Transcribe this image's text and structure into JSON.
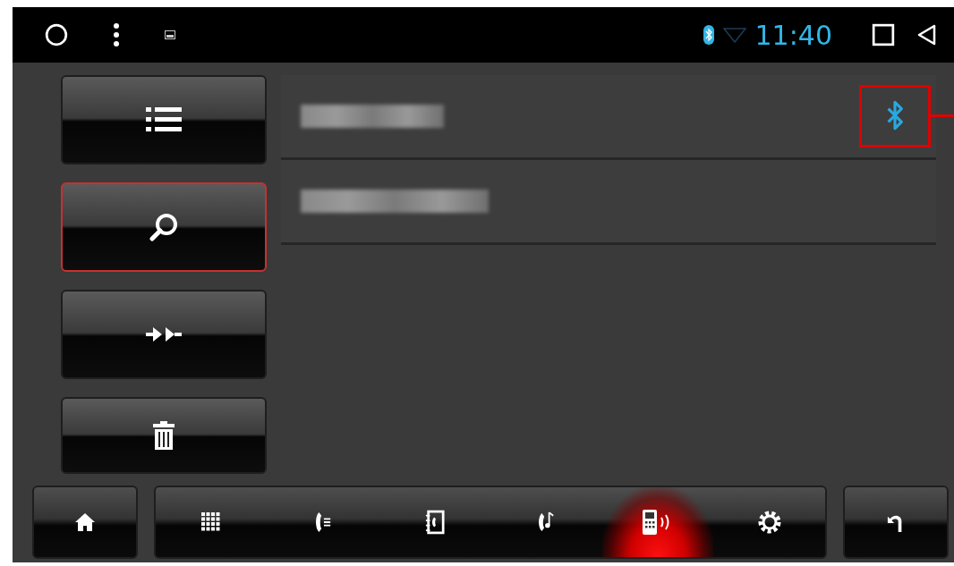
{
  "status_bar": {
    "time": "11:40",
    "bluetooth": true
  },
  "side_buttons": [
    {
      "kind": "list",
      "selected": false
    },
    {
      "kind": "search",
      "selected": true
    },
    {
      "kind": "connect",
      "selected": false
    },
    {
      "kind": "delete",
      "selected": false
    }
  ],
  "devices": [
    {
      "connected": true,
      "highlighted": true
    },
    {
      "connected": false,
      "highlighted": false
    }
  ],
  "bottom_bar": [
    {
      "kind": "home",
      "selected": false
    },
    {
      "kind": "dialpad",
      "selected": false
    },
    {
      "kind": "call-log",
      "selected": false
    },
    {
      "kind": "contacts",
      "selected": false
    },
    {
      "kind": "music",
      "selected": false
    },
    {
      "kind": "phone",
      "selected": true
    },
    {
      "kind": "settings",
      "selected": false
    },
    {
      "kind": "back",
      "selected": false
    }
  ]
}
